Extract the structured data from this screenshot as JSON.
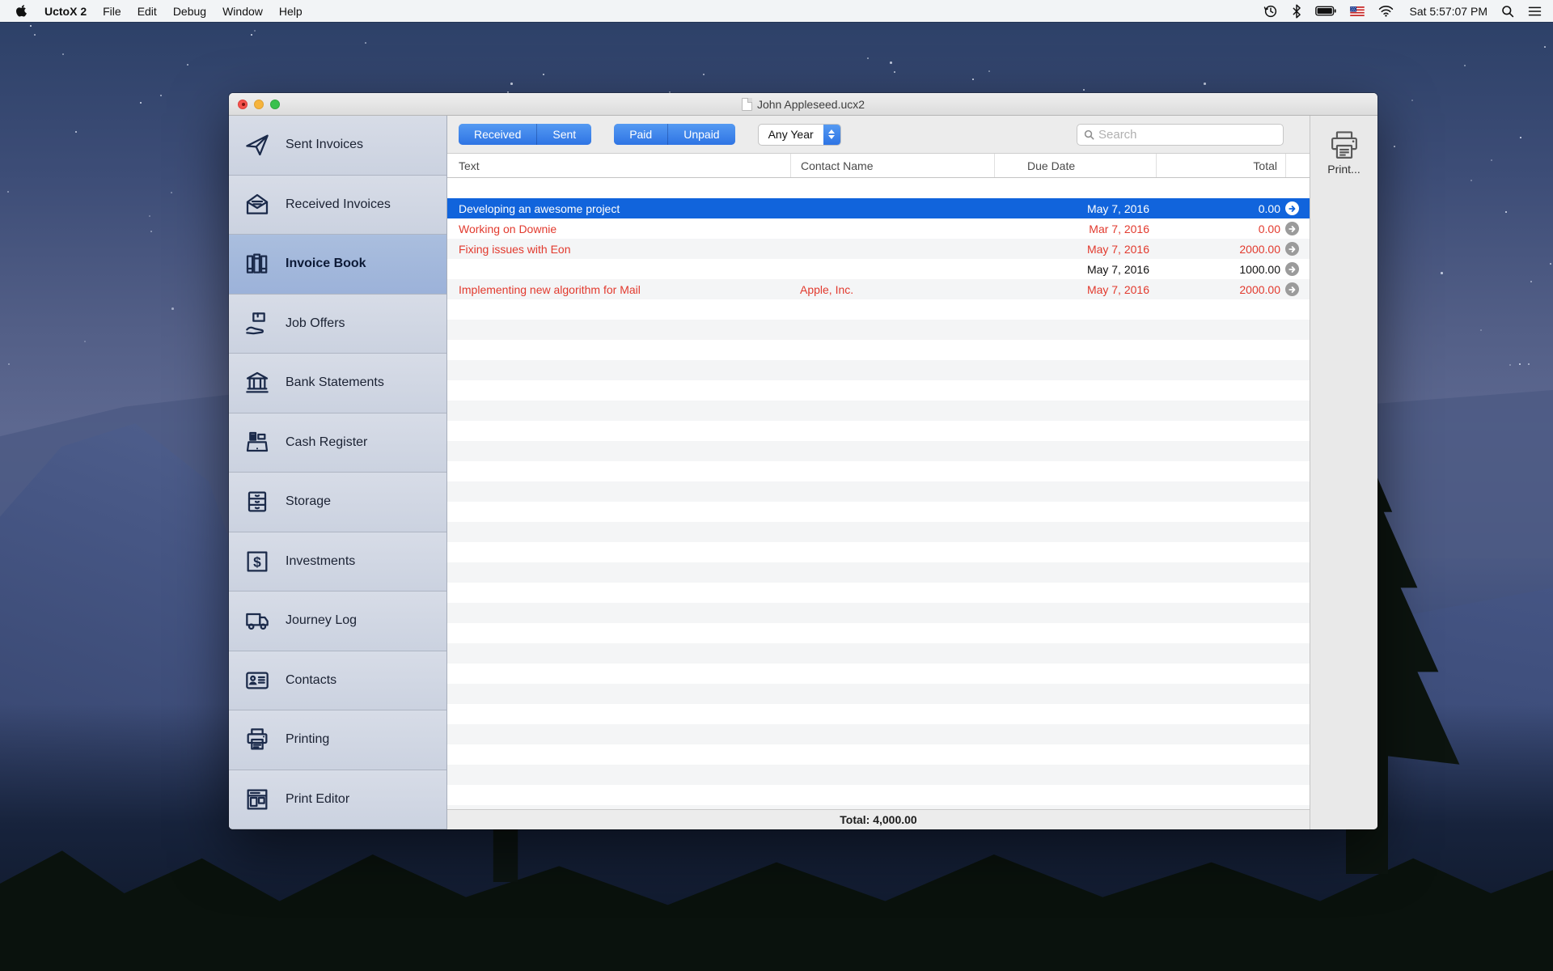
{
  "menu_bar": {
    "app_name": "UctoX 2",
    "menus": [
      "File",
      "Edit",
      "Debug",
      "Window",
      "Help"
    ],
    "status_icons": [
      "time-machine-icon",
      "bluetooth-icon",
      "battery-icon",
      "us-flag-icon",
      "wifi-icon"
    ],
    "clock": "Sat 5:57:07 PM",
    "right_icons": [
      "spotlight-icon",
      "notification-center-icon"
    ]
  },
  "window": {
    "title": "John Appleseed.ucx2",
    "sidebar": {
      "selected_index": 2,
      "items": [
        {
          "label": "Sent Invoices",
          "icon": "paper-plane-icon"
        },
        {
          "label": "Received Invoices",
          "icon": "open-envelope-icon"
        },
        {
          "label": "Invoice Book",
          "icon": "books-icon"
        },
        {
          "label": "Job Offers",
          "icon": "hand-box-icon"
        },
        {
          "label": "Bank Statements",
          "icon": "bank-icon"
        },
        {
          "label": "Cash Register",
          "icon": "cash-register-icon"
        },
        {
          "label": "Storage",
          "icon": "drawers-icon"
        },
        {
          "label": "Investments",
          "icon": "dollar-square-icon"
        },
        {
          "label": "Journey Log",
          "icon": "truck-icon"
        },
        {
          "label": "Contacts",
          "icon": "contact-card-icon"
        },
        {
          "label": "Printing",
          "icon": "printer-icon"
        },
        {
          "label": "Print Editor",
          "icon": "print-editor-icon"
        }
      ]
    },
    "toolbar": {
      "segment_received_sent": [
        "Received",
        "Sent"
      ],
      "segment_paid_unpaid": [
        "Paid",
        "Unpaid"
      ],
      "year_filter": "Any Year",
      "search_placeholder": "Search",
      "print_label": "Print..."
    },
    "table": {
      "columns": [
        "Text",
        "Contact Name",
        "Due Date",
        "Total"
      ],
      "rows": [
        {
          "text": "Developing an awesome project",
          "contact": "",
          "due": "May 7, 2016",
          "total": "0.00",
          "state": "selected"
        },
        {
          "text": "Working on Downie",
          "contact": "",
          "due": "Mar 7, 2016",
          "total": "0.00",
          "state": "red"
        },
        {
          "text": "Fixing issues with Eon",
          "contact": "",
          "due": "May 7, 2016",
          "total": "2000.00",
          "state": "red"
        },
        {
          "text": "",
          "contact": "",
          "due": "May 7, 2016",
          "total": "1000.00",
          "state": "normal"
        },
        {
          "text": "Implementing new algorithm for Mail",
          "contact": "Apple, Inc.",
          "due": "May 7, 2016",
          "total": "2000.00",
          "state": "red"
        }
      ],
      "total_label": "Total: 4,000.00"
    }
  },
  "colors": {
    "selection_blue": "#1164dc",
    "control_blue": "#3a7de8",
    "overdue_red": "#e23a2e",
    "sidebar_selected": "#a2b7dc"
  }
}
